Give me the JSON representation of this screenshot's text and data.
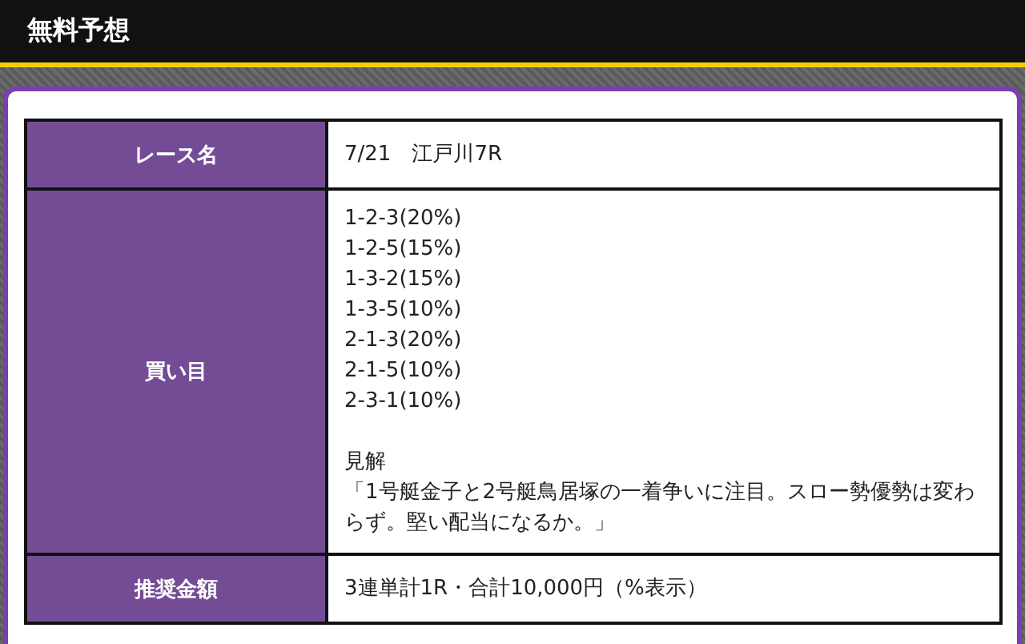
{
  "header": {
    "title": "無料予想"
  },
  "table": {
    "rows": [
      {
        "kind": "text",
        "label": "レース名",
        "value": "7/21　江戸川7R"
      },
      {
        "kind": "picks",
        "label": "買い目",
        "bets": [
          "1-2-3(20%)",
          "1-2-5(15%)",
          "1-3-2(15%)",
          "1-3-5(10%)",
          "2-1-3(20%)",
          "2-1-5(10%)",
          "2-3-1(10%)"
        ],
        "comment_title": "見解",
        "comment": "「1号艇金子と2号艇鳥居塚の一着争いに注目。スロー勢優勢は変わらず。堅い配当になるか。」"
      },
      {
        "kind": "text",
        "label": "推奨金額",
        "value": "3連単計1R・合計10,000円（%表示）"
      }
    ]
  }
}
